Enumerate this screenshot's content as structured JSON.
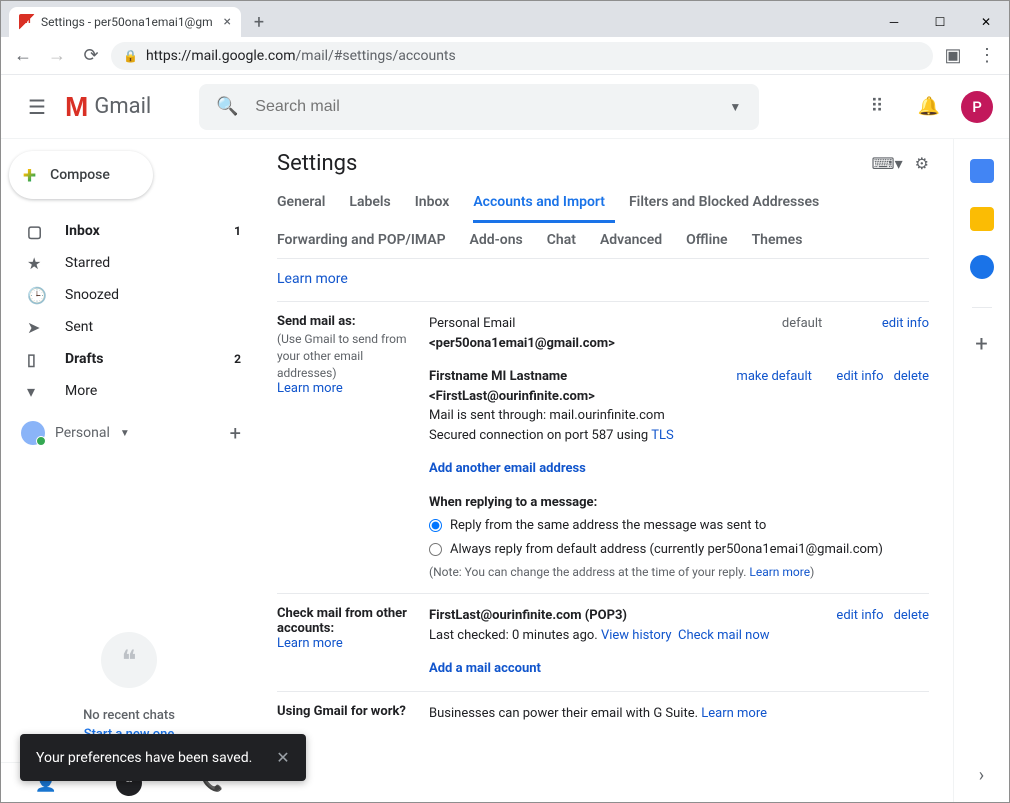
{
  "browser": {
    "tab_title": "Settings - per50ona1emai1@gm",
    "url_host": "https://mail.google.com",
    "url_path": "/mail/#settings/accounts"
  },
  "header": {
    "logo_text": "Gmail",
    "search_placeholder": "Search mail",
    "avatar_letter": "P"
  },
  "compose_label": "Compose",
  "nav": [
    {
      "icon": "inbox",
      "label": "Inbox",
      "count": "1",
      "bold": true
    },
    {
      "icon": "star",
      "label": "Starred"
    },
    {
      "icon": "clock",
      "label": "Snoozed"
    },
    {
      "icon": "send",
      "label": "Sent"
    },
    {
      "icon": "file",
      "label": "Drafts",
      "count": "2",
      "bold": true
    },
    {
      "icon": "chevron",
      "label": "More"
    }
  ],
  "personal_label": "Personal",
  "hangouts": {
    "line1": "No recent chats",
    "line2": "Start a new one"
  },
  "settings": {
    "title": "Settings",
    "tabs": [
      "General",
      "Labels",
      "Inbox",
      "Accounts and Import",
      "Filters and Blocked Addresses",
      "Forwarding and POP/IMAP",
      "Add-ons",
      "Chat",
      "Advanced",
      "Offline",
      "Themes"
    ],
    "active_tab": "Accounts and Import",
    "learn_more": "Learn more",
    "send_as": {
      "title": "Send mail as:",
      "sub": "(Use Gmail to send from your other email addresses)",
      "acct1": {
        "name": "Personal Email",
        "addr": "<per50ona1emai1@gmail.com>",
        "default_label": "default",
        "edit": "edit info"
      },
      "acct2": {
        "name": "Firstname MI Lastname",
        "addr": "<FirstLast@ourinfinite.com>",
        "detail1": "Mail is sent through: mail.ourinfinite.com",
        "detail2_a": "Secured connection on port 587 using ",
        "detail2_b": "TLS",
        "make_default": "make default",
        "edit": "edit info",
        "delete": "delete"
      },
      "add_link": "Add another email address",
      "reply_heading": "When replying to a message:",
      "reply_opt1": "Reply from the same address the message was sent to",
      "reply_opt2a": "Always reply from default address (currently ",
      "reply_opt2b": "per50ona1emai1@gmail.com)",
      "note_a": "(Note: You can change the address at the time of your reply. ",
      "note_b": "Learn more",
      "note_c": ")"
    },
    "check_mail": {
      "title": "Check mail from other accounts:",
      "addr": "FirstLast@ourinfinite.com (POP3)",
      "status_a": "Last checked: 0 minutes ago. ",
      "view_history": "View history",
      "check_now": "Check mail now",
      "edit": "edit info",
      "delete": "delete",
      "add_link": "Add a mail account"
    },
    "gsuite": {
      "title": "Using Gmail for work?",
      "text": "Businesses can power their email with G Suite. ",
      "learn": "Learn more"
    }
  },
  "toast_text": "Your preferences have been saved."
}
